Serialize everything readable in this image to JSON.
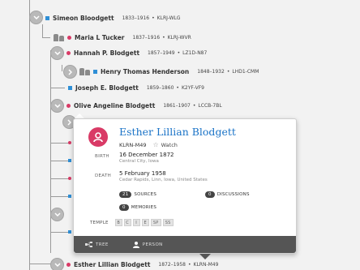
{
  "tree": [
    {
      "name": "Simeon Bloodgett",
      "years": "1833–1916",
      "id": "KLRJ-WLG"
    },
    {
      "name": "Maria L Tucker",
      "years": "1837–1916",
      "id": "KLRJ-WVR"
    },
    {
      "name": "Hannah P. Blodgett",
      "years": "1857–1949",
      "id": "LZ1D-N87"
    },
    {
      "name": "Henry Thomas Henderson",
      "years": "1848–1932",
      "id": "LHD1-CMM"
    },
    {
      "name": "Joseph E. Blodgett",
      "years": "1859–1860",
      "id": "K2YF-VF9"
    },
    {
      "name": "Olive Angeline Blodgett",
      "years": "1861–1907",
      "id": "LCCB-7BL"
    },
    {
      "name": "Esther Lillian Blodgett",
      "years": "1872–1958",
      "id": "KLRN-M49"
    }
  ],
  "card": {
    "name": "Esther Lillian Blodgett",
    "id": "KLRN-M49",
    "watch": "Watch",
    "birth_label": "BIRTH",
    "birth_date": "16 December 1872",
    "birth_place": "Central City, Iowa",
    "death_label": "DEATH",
    "death_date": "5 February 1958",
    "death_place": "Cedar Rapids, Linn, Iowa, United States",
    "sources_count": "21",
    "sources_label": "SOURCES",
    "discussions_count": "0",
    "discussions_label": "DISCUSSIONS",
    "memories_count": "0",
    "memories_label": "MEMORIES",
    "temple_label": "TEMPLE",
    "temple": [
      "B",
      "C",
      "I",
      "E",
      "SP",
      "SS"
    ],
    "foot_tree": "TREE",
    "foot_person": "PERSON"
  },
  "colors": {
    "male": "#2e8fd6",
    "female": "#d93a66",
    "link": "#1a73c7",
    "footer": "#555555"
  },
  "icons": [
    "collapse-chevron-icon",
    "expand-chevron-icon",
    "couple-icon",
    "female-avatar-icon",
    "star-icon",
    "tree-icon",
    "person-icon"
  ]
}
